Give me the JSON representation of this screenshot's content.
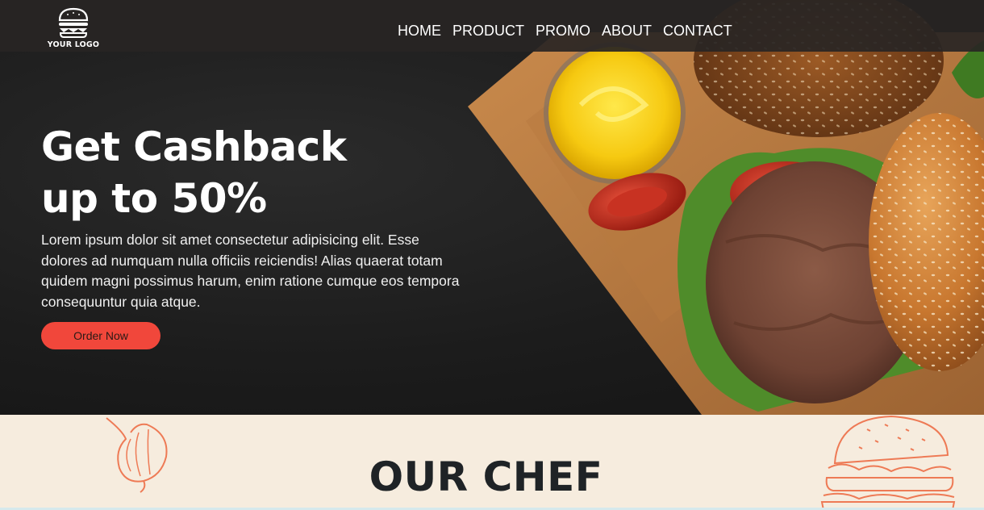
{
  "header": {
    "logo_text": "YOUR LOGO",
    "nav": [
      "HOME",
      "PRODUCT",
      "PROMO",
      "ABOUT",
      "CONTACT"
    ]
  },
  "hero": {
    "headline_line1": "Get Cashback",
    "headline_line2": "up to 50%",
    "description": "Lorem ipsum dolor sit amet consectetur adipisicing elit. Esse dolores ad numquam nulla officiis reiciendis! Alias quaerat totam quidem magni possimus harum, enim ratione cumque eos tempora consequuntur quia atque.",
    "cta_label": "Order Now"
  },
  "chef": {
    "title": "OUR CHEF"
  },
  "colors": {
    "accent": "#f1473b",
    "header_bg": "#282524",
    "section_bg": "#f6ecde",
    "title_text": "#1f2326"
  }
}
